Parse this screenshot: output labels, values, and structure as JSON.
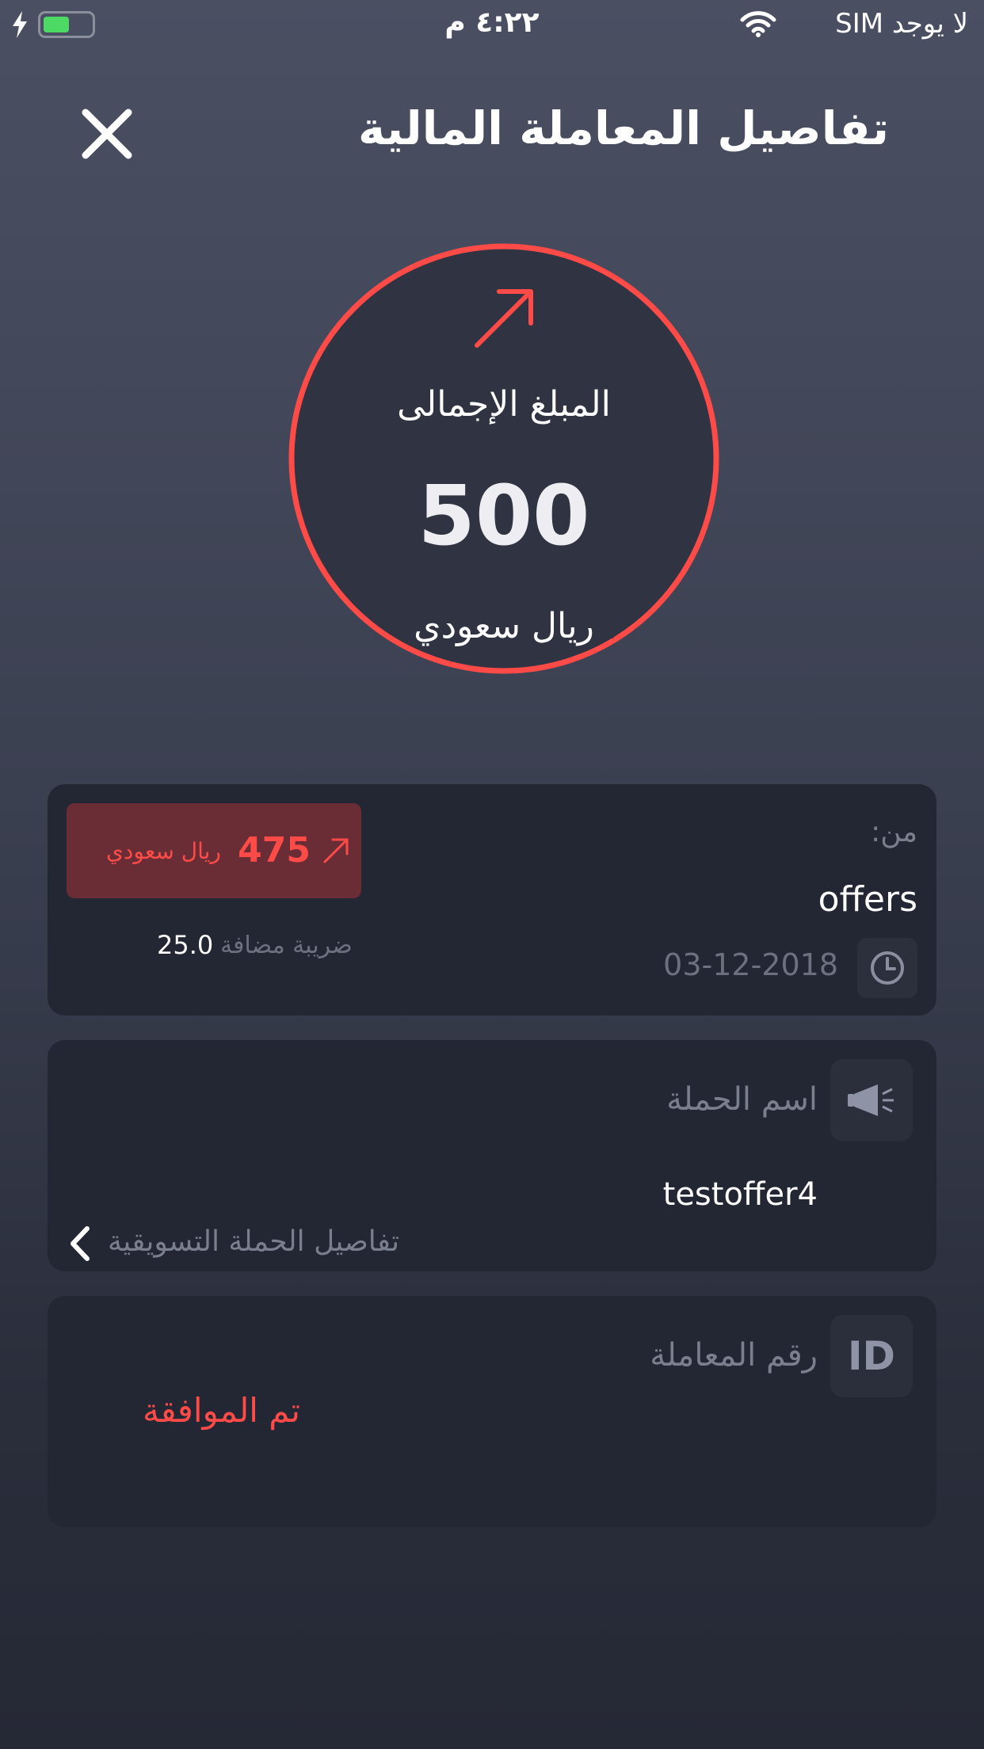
{
  "status_bar": {
    "time": "٤:٢٢ م",
    "carrier": "لا يوجد SIM"
  },
  "header": {
    "title": "تفاصيل المعاملة المالية"
  },
  "summary": {
    "label": "المبلغ الإجمالى",
    "amount": "500",
    "currency": "ريال سعودي",
    "accent_color": "#ff4b47"
  },
  "transaction_card": {
    "from_label": "من:",
    "from_value": "offers",
    "date": "03-12-2018",
    "net_amount": "475",
    "net_currency": "ريال سعودي",
    "vat_label": "ضريبة مضافة",
    "vat_value": "25.0"
  },
  "campaign_card": {
    "label": "اسم الحملة",
    "value": "testoffer4",
    "link_text": "تفاصيل الحملة التسويقية"
  },
  "id_card": {
    "icon_text": "ID",
    "label": "رقم المعاملة",
    "status": "تم الموافقة"
  },
  "icons": [
    "close-icon",
    "arrow-up-right-icon",
    "clock-icon",
    "megaphone-icon",
    "chevron-left-icon",
    "wifi-icon",
    "battery-icon"
  ]
}
